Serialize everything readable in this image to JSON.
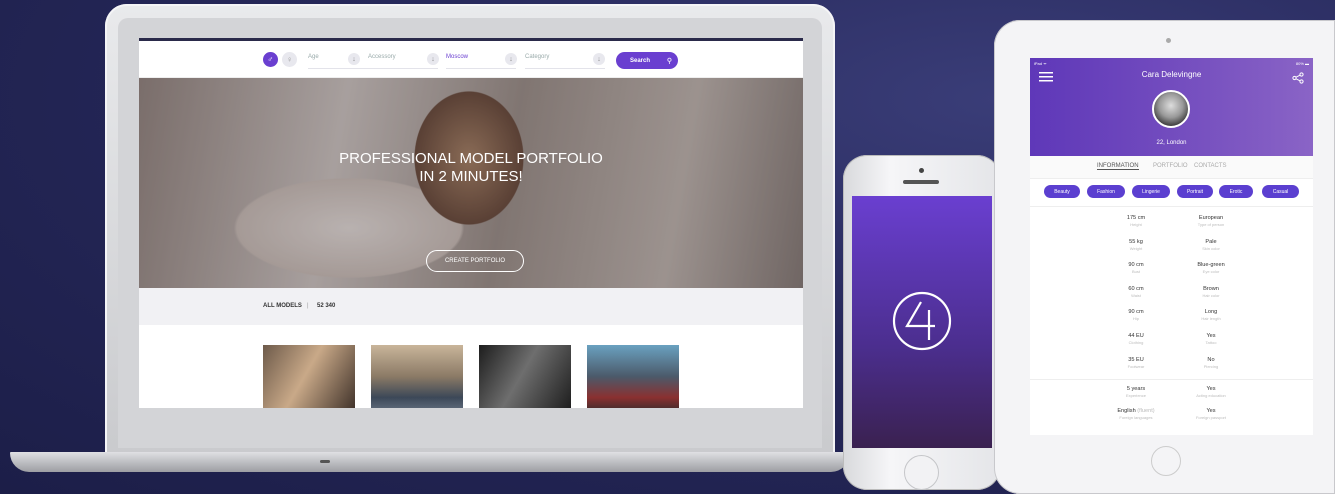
{
  "laptop": {
    "topbar": {
      "age_label": "Age",
      "accessory_label": "Accessory",
      "city_label": "Moscow",
      "category_label": "Category",
      "search_label": "Search",
      "search_icon": "search-icon"
    },
    "hero": {
      "title_line1": "PROFESSIONAL MODEL PORTFOLIO",
      "title_line2": "IN 2 MINUTES!",
      "button": "CREATE PORTFOLIO"
    },
    "stats": {
      "label": "ALL MODELS",
      "separator": "|",
      "count": "52 340"
    }
  },
  "tablet": {
    "status_left": "iPad ᯤ",
    "status_right": "80% ▬",
    "name": "Cara Delevingne",
    "location": "22, London",
    "tabs": [
      "INFORMATION",
      "PORTFOLIO",
      "CONTACTS"
    ],
    "chips": [
      "Beauty",
      "Fashion",
      "Lingerie",
      "Portrait",
      "Erotic",
      "Casual"
    ],
    "attrs_left": [
      {
        "value": "175 cm",
        "label": "Height"
      },
      {
        "value": "55 kg",
        "label": "Weight"
      },
      {
        "value": "90 cm",
        "label": "Bust"
      },
      {
        "value": "60 cm",
        "label": "Waist"
      },
      {
        "value": "90 cm",
        "label": "Hip"
      },
      {
        "value": "44 EU",
        "label": "Clothing"
      },
      {
        "value": "35 EU",
        "label": "Footwear"
      }
    ],
    "attrs_right": [
      {
        "value": "European",
        "label": "Type of person"
      },
      {
        "value": "Pale",
        "label": "Skin color"
      },
      {
        "value": "Blue-green",
        "label": "Eye color"
      },
      {
        "value": "Brown",
        "label": "Hair color"
      },
      {
        "value": "Long",
        "label": "Hair length"
      },
      {
        "value": "Yes",
        "label": "Tattoo"
      },
      {
        "value": "No",
        "label": "Piercing"
      }
    ],
    "extra_left": [
      {
        "value": "5 years",
        "label": "Experience"
      },
      {
        "value": "English",
        "value_muted": "(fluent)",
        "label": "Foreign languages"
      }
    ],
    "extra_right": [
      {
        "value": "Yes",
        "label": "Acting education"
      },
      {
        "value": "Yes",
        "label": "Foreign passport"
      }
    ]
  },
  "colors": {
    "accent": "#6a3fd0",
    "background": "#26285a"
  }
}
